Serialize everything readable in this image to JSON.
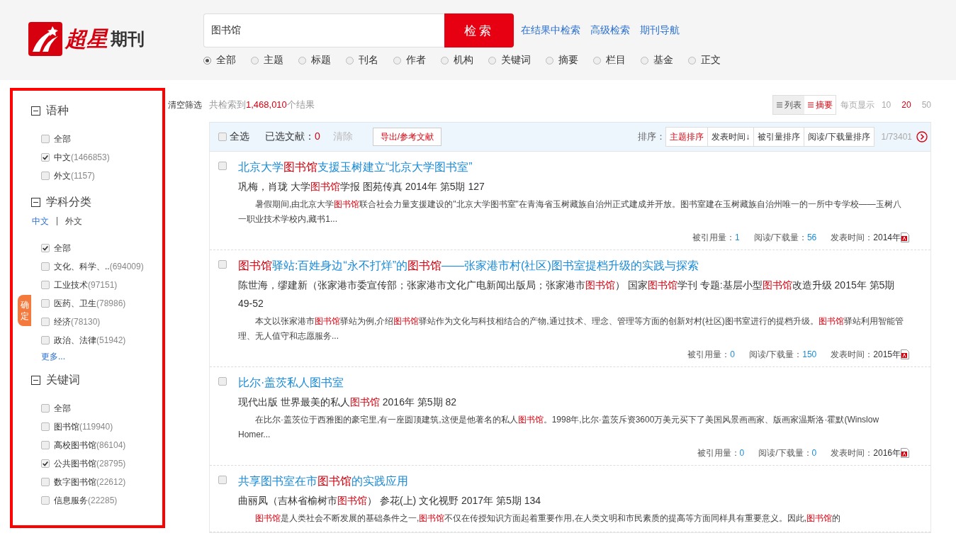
{
  "logo": {
    "brand": "超星",
    "product": "期刊"
  },
  "search": {
    "value": "图书馆",
    "button": "检索",
    "links": [
      "在结果中检索",
      "高级检索",
      "期刊导航"
    ],
    "scopes": [
      {
        "label": "全部",
        "selected": true
      },
      {
        "label": "主题",
        "selected": false
      },
      {
        "label": "标题",
        "selected": false
      },
      {
        "label": "刊名",
        "selected": false
      },
      {
        "label": "作者",
        "selected": false
      },
      {
        "label": "机构",
        "selected": false
      },
      {
        "label": "关键词",
        "selected": false
      },
      {
        "label": "摘要",
        "selected": false
      },
      {
        "label": "栏目",
        "selected": false
      },
      {
        "label": "基金",
        "selected": false
      },
      {
        "label": "正文",
        "selected": false
      }
    ]
  },
  "sidebar": {
    "confirm": "确定",
    "sections": [
      {
        "title": "语种",
        "expanded": true,
        "items": [
          {
            "label": "全部",
            "checked": false
          },
          {
            "label": "中文",
            "count": "(1466853)",
            "checked": true
          },
          {
            "label": "外文",
            "count": "(1157)",
            "checked": false
          }
        ]
      },
      {
        "title": "学科分类",
        "expanded": true,
        "tabs": [
          {
            "label": "中文",
            "selected": true
          },
          {
            "label": "外文",
            "selected": false
          }
        ],
        "tab_separator": "|",
        "items": [
          {
            "label": "全部",
            "checked": true
          },
          {
            "label": "文化、科学、..",
            "count": "(694009)",
            "checked": false
          },
          {
            "label": "工业技术",
            "count": "(97151)",
            "checked": false
          },
          {
            "label": "医药、卫生",
            "count": "(78986)",
            "checked": false
          },
          {
            "label": "经济",
            "count": "(78130)",
            "checked": false
          },
          {
            "label": "政治、法律",
            "count": "(51942)",
            "checked": false
          }
        ],
        "more": "更多..."
      },
      {
        "title": "关键词",
        "expanded": true,
        "items": [
          {
            "label": "全部",
            "checked": false
          },
          {
            "label": "图书馆",
            "count": "(119940)",
            "checked": false
          },
          {
            "label": "高校图书馆",
            "count": "(86104)",
            "checked": false
          },
          {
            "label": "公共图书馆",
            "count": "(28795)",
            "checked": true
          },
          {
            "label": "数字图书馆",
            "count": "(22612)",
            "checked": false
          },
          {
            "label": "信息服务",
            "count": "(22285)",
            "checked": false
          }
        ]
      }
    ]
  },
  "clear_filters": "清空筛选",
  "summary": {
    "prefix": "共检索到",
    "count": "1,468,010",
    "suffix": "个结果"
  },
  "views": [
    {
      "label": "列表",
      "selected": false
    },
    {
      "label": "摘要",
      "selected": true
    }
  ],
  "page_size": {
    "label": "每页显示",
    "options": [
      {
        "label": "10",
        "selected": false
      },
      {
        "label": "20",
        "selected": true
      },
      {
        "label": "50",
        "selected": false
      }
    ]
  },
  "toolbar": {
    "select_all": "全选",
    "select_all_checked": false,
    "selected_label": "已选文献：",
    "selected_count": "0",
    "clear": "清除",
    "export": "导出/参考文献",
    "sort_label": "排序：",
    "sorts": [
      {
        "label": "主题排序",
        "selected": true
      },
      {
        "label": "发表时间↓",
        "selected": false
      },
      {
        "label": "被引量排序",
        "selected": false
      },
      {
        "label": "阅读/下载量排序",
        "selected": false
      }
    ],
    "pages": "1/73401"
  },
  "results": [
    {
      "selected": false,
      "title": [
        {
          "t": "北京大学",
          "hit": false
        },
        {
          "t": "图书馆",
          "hit": true
        },
        {
          "t": "支援玉树建立“北京大学图书室”",
          "hit": false
        }
      ],
      "meta": [
        {
          "t": "巩梅，肖珑 大学",
          "hit": false
        },
        {
          "t": "图书馆",
          "hit": true
        },
        {
          "t": "学报 图苑传真  2014年 第5期 127",
          "hit": false
        }
      ],
      "abstract": [
        {
          "t": "暑假期间,由北京大学",
          "hit": false
        },
        {
          "t": "图书馆",
          "hit": true
        },
        {
          "t": "联合社会力量支援建设的\"北京大学图书室\"在青海省玉树藏族自治州正式建成并开放。图书室建在玉树藏族自治州唯一的一所中专学校——玉树八一职业技术学校内,藏书1...",
          "hit": false
        }
      ],
      "stats": [
        {
          "label": "被引用量：",
          "value": "1",
          "kind": "count"
        },
        {
          "label": "阅读/下载量：",
          "value": "56",
          "kind": "count"
        },
        {
          "label": "发表时间：",
          "value": "2014年",
          "kind": "date"
        }
      ]
    },
    {
      "selected": false,
      "title": [
        {
          "t": "图书馆",
          "hit": true
        },
        {
          "t": "驿站:百姓身边“永不打烊”的",
          "hit": false
        },
        {
          "t": "图书馆",
          "hit": true
        },
        {
          "t": "——张家港市村(社区)图书室提档升级的实践与探索",
          "hit": false
        }
      ],
      "meta": [
        {
          "t": "陈世海，缪建新（张家港市委宣传部；张家港市文化广电新闻出版局；张家港市",
          "hit": false
        },
        {
          "t": "图书馆",
          "hit": true
        },
        {
          "t": "） 国家",
          "hit": false
        },
        {
          "t": "图书馆",
          "hit": true
        },
        {
          "t": "学刊 专题:基层小型",
          "hit": false
        },
        {
          "t": "图书馆",
          "hit": true
        },
        {
          "t": "改造升级  2015年 第5期 49-52",
          "hit": false
        }
      ],
      "abstract": [
        {
          "t": "本文以张家港市",
          "hit": false
        },
        {
          "t": "图书馆",
          "hit": true
        },
        {
          "t": "驿站为例,介绍",
          "hit": false
        },
        {
          "t": "图书馆",
          "hit": true
        },
        {
          "t": "驿站作为文化与科技相结合的产物,通过技术、理念、管理等方面的创新对村(社区)图书室进行的提档升级。",
          "hit": false
        },
        {
          "t": "图书馆",
          "hit": true
        },
        {
          "t": "驿站利用智能管理、无人值守和志愿服务...",
          "hit": false
        }
      ],
      "stats": [
        {
          "label": "被引用量：",
          "value": "0",
          "kind": "count"
        },
        {
          "label": "阅读/下载量：",
          "value": "150",
          "kind": "count"
        },
        {
          "label": "发表时间：",
          "value": "2015年",
          "kind": "date"
        }
      ]
    },
    {
      "selected": false,
      "title": [
        {
          "t": "比尔·盖茨私人图书室",
          "hit": false
        }
      ],
      "meta": [
        {
          "t": "现代出版 世界最美的私人",
          "hit": false
        },
        {
          "t": "图书馆",
          "hit": true
        },
        {
          "t": "  2016年 第5期 82",
          "hit": false
        }
      ],
      "abstract": [
        {
          "t": "在比尔·盖茨位于西雅图的豪宅里,有一座圆顶建筑,这便是他著名的私人",
          "hit": false
        },
        {
          "t": "图书馆",
          "hit": true
        },
        {
          "t": "。1998年,比尔·盖茨斥资3600万美元买下了美国风景画画家、版画家温斯洛·霍默(Winslow Homer...",
          "hit": false
        }
      ],
      "stats": [
        {
          "label": "被引用量：",
          "value": "0",
          "kind": "count"
        },
        {
          "label": "阅读/下载量：",
          "value": "0",
          "kind": "count"
        },
        {
          "label": "发表时间：",
          "value": "2016年",
          "kind": "date"
        }
      ]
    },
    {
      "selected": false,
      "title": [
        {
          "t": "共享图书室在市",
          "hit": false
        },
        {
          "t": "图书馆",
          "hit": true
        },
        {
          "t": "的实践应用",
          "hit": false
        }
      ],
      "meta": [
        {
          "t": "曲丽凤（吉林省榆树市",
          "hit": false
        },
        {
          "t": "图书馆",
          "hit": true
        },
        {
          "t": "） 参花(上) 文化视野  2017年 第5期 134",
          "hit": false
        }
      ],
      "abstract": [
        {
          "t": "图书馆",
          "hit": true
        },
        {
          "t": "是人类社会不断发展的基础条件之一,",
          "hit": false
        },
        {
          "t": "图书馆",
          "hit": true
        },
        {
          "t": "不仅在传授知识方面起着重要作用,在人类文明和市民素质的提高等方面同样具有重要意义。因此,",
          "hit": false
        },
        {
          "t": "图书馆",
          "hit": true
        },
        {
          "t": "的",
          "hit": false
        }
      ]
    }
  ]
}
